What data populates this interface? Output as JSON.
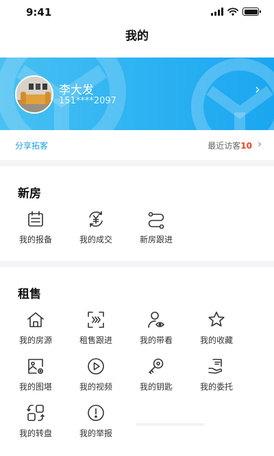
{
  "status_bar": {
    "time": "9:41"
  },
  "header": {
    "title": "我的"
  },
  "profile": {
    "name": "李大发",
    "phone": "151****2097"
  },
  "share_row": {
    "share_label": "分享拓客",
    "visitors_label": "最近访客",
    "visitors_count": "10"
  },
  "new_house": {
    "title": "新房",
    "items": [
      {
        "label": "我的报备",
        "icon": "calendar-icon"
      },
      {
        "label": "我的成交",
        "icon": "yuan-cycle-icon"
      },
      {
        "label": "新房跟进",
        "icon": "route-icon"
      }
    ]
  },
  "rent_sale": {
    "title": "租售",
    "items": [
      {
        "label": "我的房源",
        "icon": "house-icon"
      },
      {
        "label": "租售跟进",
        "icon": "scan-forward-icon"
      },
      {
        "label": "我的带看",
        "icon": "user-eye-icon"
      },
      {
        "label": "我的收藏",
        "icon": "star-icon"
      },
      {
        "label": "我的图堪",
        "icon": "image-gear-icon"
      },
      {
        "label": "我的视频",
        "icon": "play-icon"
      },
      {
        "label": "我的钥匙",
        "icon": "key-icon"
      },
      {
        "label": "我的委托",
        "icon": "hand-document-icon"
      },
      {
        "label": "我的转盘",
        "icon": "transfer-icon"
      },
      {
        "label": "我的举报",
        "icon": "report-icon"
      }
    ]
  },
  "colors": {
    "accent": "#2cb2f2",
    "link": "#1ea0e8",
    "highlight": "#f0421f"
  }
}
